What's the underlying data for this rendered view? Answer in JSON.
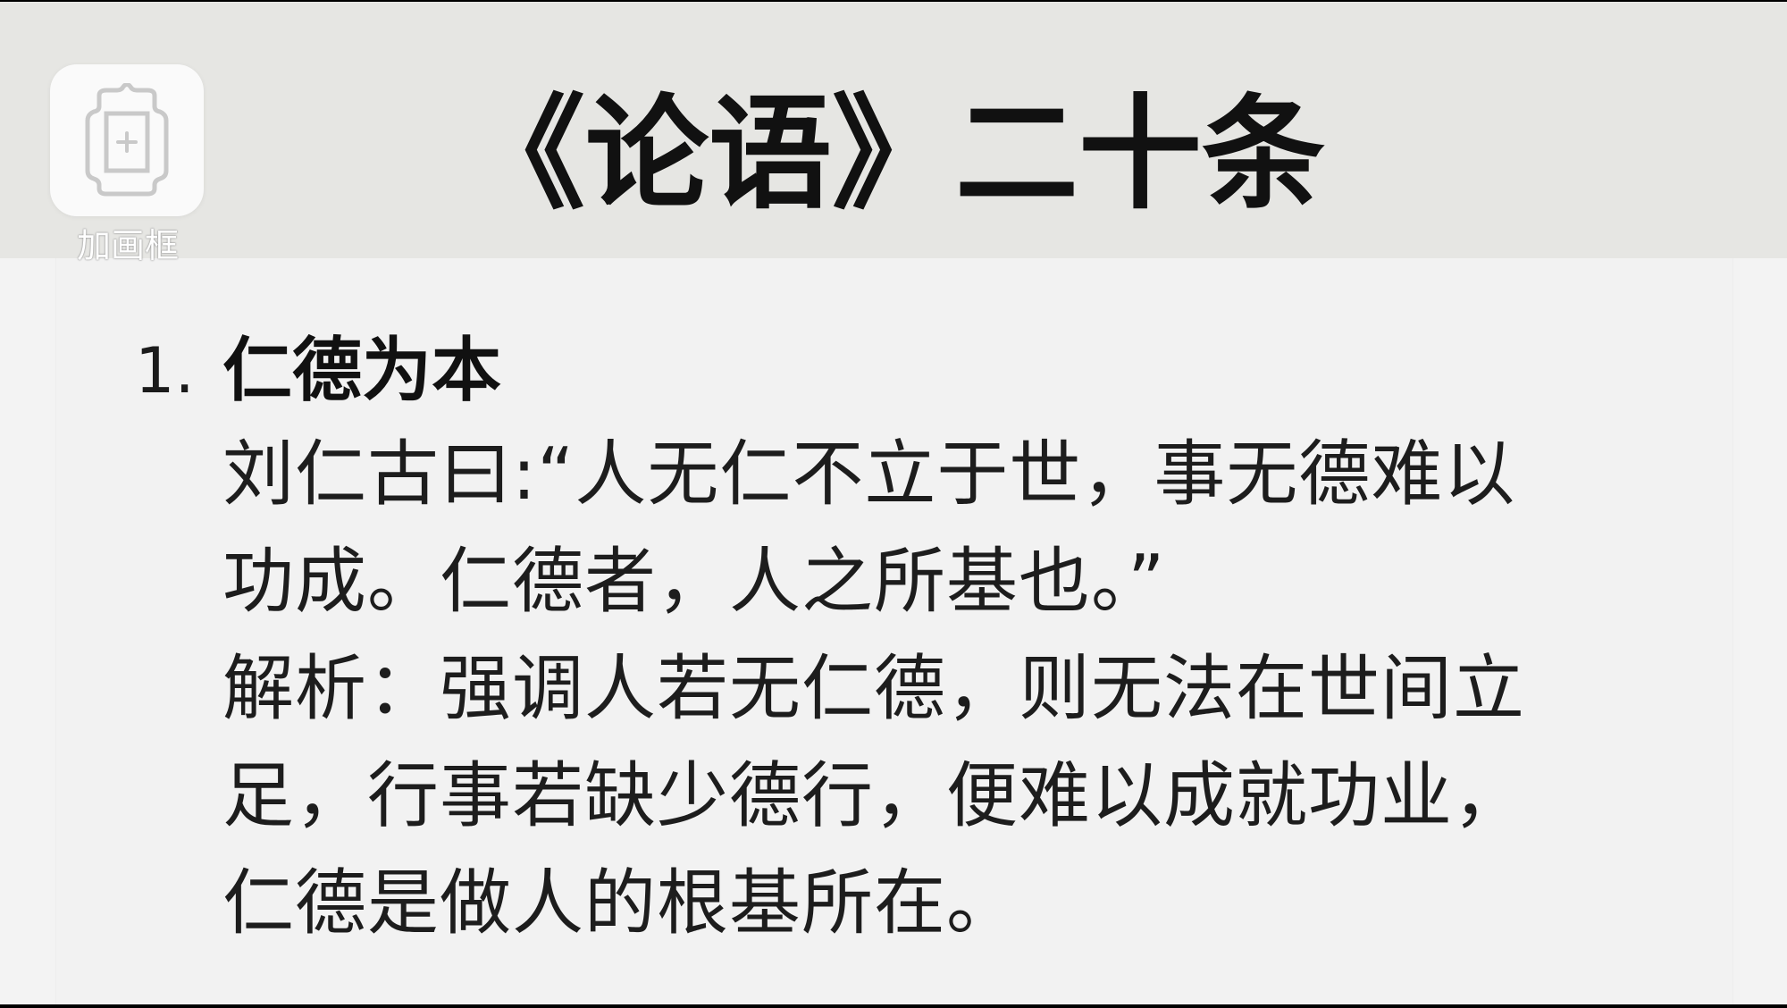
{
  "header": {
    "title": "《论语》二十条",
    "background": "#e6e6e3"
  },
  "frame_tool": {
    "label": "加画框",
    "icon": "frame-add-icon"
  },
  "article": {
    "item_number": "1.",
    "item_title": "仁德为本",
    "quote_lines": [
      "刘仁古曰:“人无仁不立于世，事无德难以",
      "功成。仁德者，人之所基也。”"
    ],
    "analysis_lines": [
      "解析：强调人若无仁德，则无法在世间立",
      "足，行事若缺少德行，便难以成就功业，",
      "仁德是做人的根基所在。"
    ]
  },
  "colors": {
    "content_background": "#f2f2f2",
    "text": "#1d1d1d"
  }
}
